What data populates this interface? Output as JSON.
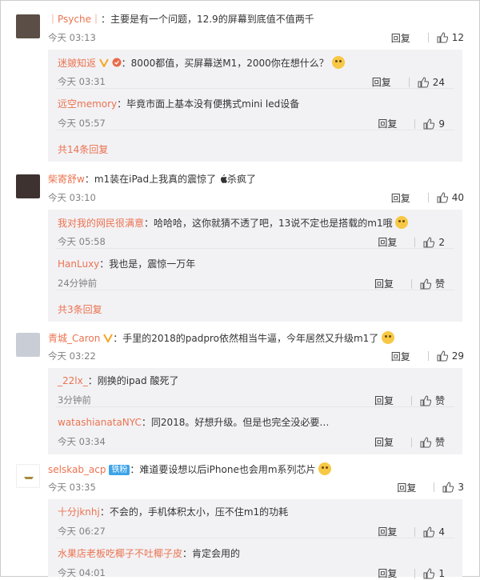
{
  "comments": [
    {
      "user": "｜Psyche｜",
      "text": "：主要是有一个问题，12.9的屏幕到底值不值两千",
      "time": "今天 03:13",
      "reply": "回复",
      "likes": "12",
      "avatar_color": "#5a4e46",
      "replies": [
        {
          "user": "迷皴知返",
          "text": "：8000都值，买屏幕送M1，2000你在想什么？",
          "time": "今天 03:31",
          "reply": "回复",
          "likes": "24"
        },
        {
          "user": "远空memory",
          "text": "：毕竟市面上基本没有便携式mini led设备",
          "time": "今天 05:57",
          "reply": "回复",
          "likes": "9"
        }
      ],
      "more": "共14条回复"
    },
    {
      "user": "柴寄舒w",
      "text": "：m1装在iPad上我真的震惊了",
      "text2": "杀疯了",
      "time": "今天 03:10",
      "reply": "回复",
      "likes": "40",
      "avatar_color": "#3d3230",
      "replies": [
        {
          "user": "我对我的网民很满意",
          "text": "：哈哈哈，这你就猜不透了吧，13说不定也是搭载的m1哦",
          "time": "今天 05:58",
          "reply": "回复",
          "likes": "2"
        },
        {
          "user": "HanLuxy",
          "text": "：我也是，震惊一万年",
          "time": "24分钟前",
          "reply": "回复",
          "likes": "赞"
        }
      ],
      "more": "共3条回复"
    },
    {
      "user": "青城_Caron",
      "text": "：手里的2018的padpro依然相当牛逼，今年居然又升级m1了",
      "time": "今天 03:22",
      "reply": "回复",
      "likes": "29",
      "avatar_color": "#c9cdd6",
      "replies": [
        {
          "user": "_22lx_",
          "text": "：刚换的ipad 酸死了",
          "time": "3分钟前",
          "reply": "回复",
          "likes": "赞"
        },
        {
          "user": "watashianataNYC",
          "text": "：同2018。好想升级。但是也完全没必要…",
          "time": "今天 03:34",
          "reply": "回复",
          "likes": "赞"
        }
      ]
    },
    {
      "user": "selskab_acp",
      "tag": "铁粉",
      "text": "：难道要设想以后iPhone也会用m系列芯片",
      "time": "今天 03:35",
      "reply": "回复",
      "likes": "3",
      "avatar_color": "#ffffff",
      "replies": [
        {
          "user": "十分jknhj",
          "text": "：不会的，手机体积太小，压不住m1的功耗",
          "time": "今天 06:27",
          "reply": "回复",
          "likes": "4"
        },
        {
          "user": "水果店老板吃椰子不吐椰子皮",
          "text": "：肯定会用的",
          "time": "今天 04:01",
          "reply": "回复",
          "likes": "1"
        }
      ]
    }
  ],
  "colors": {
    "username": "#eb7350",
    "time": "#808080",
    "sub_bg": "#f2f2f5",
    "tag_bg": "#3da4e8"
  }
}
